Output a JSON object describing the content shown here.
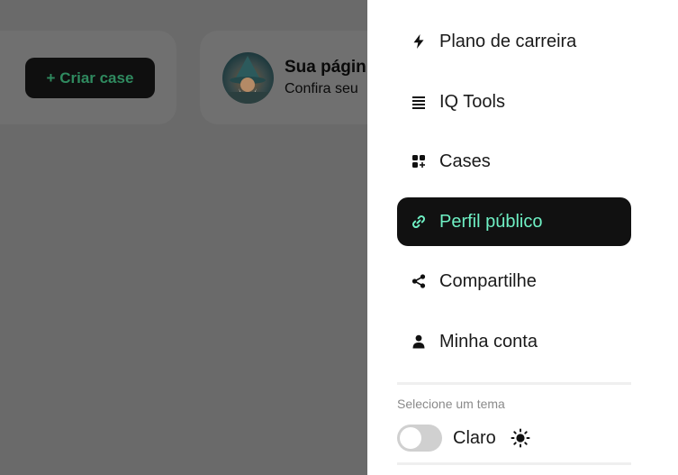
{
  "background": {
    "create_case_label": "+ Criar case",
    "profile_card": {
      "title": "Sua págin",
      "subtitle": "Confira seu"
    }
  },
  "drawer": {
    "menu": [
      {
        "label": "Plano de carreira",
        "icon": "lightning-icon"
      },
      {
        "label": "IQ Tools",
        "icon": "list-icon"
      },
      {
        "label": "Cases",
        "icon": "grid-plus-icon"
      },
      {
        "label": "Perfil público",
        "icon": "link-icon",
        "active": true
      },
      {
        "label": "Compartilhe",
        "icon": "share-icon"
      },
      {
        "label": "Minha conta",
        "icon": "person-icon"
      }
    ],
    "theme": {
      "section_label": "Selecione um tema",
      "current": "Claro",
      "enabled": false,
      "icon": "sun-icon"
    }
  },
  "colors": {
    "overlay": "#6b6b6b",
    "active_bg": "#111111",
    "active_text": "#6ff0c4",
    "create_button_text": "#2f8a5f"
  }
}
